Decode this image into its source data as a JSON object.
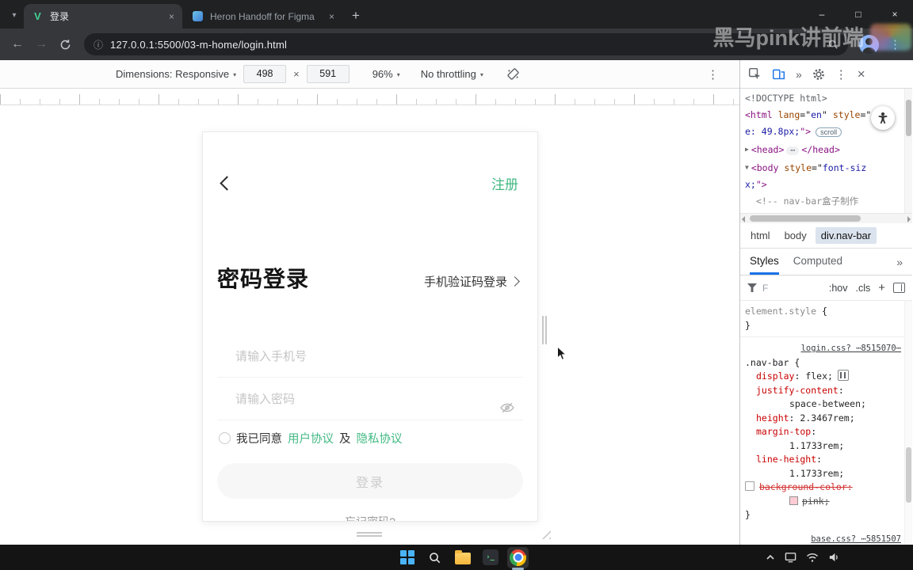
{
  "colors": {
    "accent_green": "#42b983",
    "devtools_blue": "#1a73e8",
    "disabled_pink": "#ffc0cb"
  },
  "icons": {
    "tab_search": "▾",
    "close_tab": "×",
    "new_tab": "+",
    "minimize": "–",
    "maximize": "□",
    "close_window": "×",
    "back": "←",
    "forward": "→",
    "info": "ⓘ",
    "kebab": "⋮",
    "more_panels": "»",
    "caret": "▾",
    "devtools_close": "×"
  },
  "browser": {
    "tabs": [
      {
        "title": "登录"
      },
      {
        "title": "Heron Handoff for Figma"
      }
    ],
    "url": "127.0.0.1:5500/03-m-home/login.html",
    "watermark": "黑马pink讲前端"
  },
  "device_toolbar": {
    "dimensions_label": "Dimensions: Responsive",
    "width": "498",
    "multiply": "×",
    "height": "591",
    "zoom": "96%",
    "throttling": "No throttling"
  },
  "page": {
    "register": "注册",
    "title": "密码登录",
    "alt_login": "手机验证码登录",
    "phone_placeholder": "请输入手机号",
    "password_placeholder": "请输入密码",
    "agree_prefix": "我已同意",
    "user_agreement": "用户协议",
    "and": "及",
    "privacy_agreement": "隐私协议",
    "login_button": "登录",
    "forgot_password": "忘记密码?"
  },
  "elements": {
    "dom_lines": [
      {
        "tokens": [
          {
            "c": "doctype",
            "t": "<!DOCTYPE html>"
          }
        ]
      },
      {
        "tokens": [
          {
            "c": "tag",
            "t": "<html"
          },
          {
            "c": "plain",
            "t": " "
          },
          {
            "c": "attr",
            "t": "lang"
          },
          {
            "c": "plain",
            "t": "=\""
          },
          {
            "c": "str",
            "t": "en"
          },
          {
            "c": "plain",
            "t": "\" "
          },
          {
            "c": "attr",
            "t": "style"
          },
          {
            "c": "plain",
            "t": "=\""
          },
          {
            "c": "str",
            "t": "f"
          }
        ]
      },
      {
        "tokens": [
          {
            "c": "str",
            "t": "e: 49.8px;"
          },
          {
            "c": "tag",
            "t": "\">"
          },
          {
            "k": "badge",
            "t": "scroll"
          }
        ]
      },
      {
        "tokens": [
          {
            "c": "arrow",
            "t": "▶"
          },
          {
            "c": "tag",
            "t": "<head>"
          },
          {
            "c": "dots",
            "t": "⋯"
          },
          {
            "c": "tag",
            "t": "</head>"
          }
        ]
      },
      {
        "tokens": [
          {
            "c": "arrow",
            "t": "▼"
          },
          {
            "c": "tag",
            "t": "<body"
          },
          {
            "c": "plain",
            "t": " "
          },
          {
            "c": "attr",
            "t": "style"
          },
          {
            "c": "plain",
            "t": "=\""
          },
          {
            "c": "str",
            "t": "font-siz"
          }
        ]
      },
      {
        "tokens": [
          {
            "c": "str",
            "t": "x;"
          },
          {
            "c": "tag",
            "t": "\">"
          }
        ]
      },
      {
        "indent": 1,
        "tokens": [
          {
            "c": "comment",
            "t": "<!-- nav-bar盒子制作"
          }
        ]
      }
    ],
    "breadcrumbs": [
      {
        "t": "html"
      },
      {
        "t": "body"
      },
      {
        "t": "div.nav-bar",
        "sel": true
      }
    ]
  },
  "styles": {
    "tabs": {
      "styles": "Styles",
      "computed": "Computed"
    },
    "filter": {
      "placeholder": "F",
      "hov": ":hov",
      "cls": ".cls",
      "plus": "+"
    },
    "lines": [
      {
        "tokens": [
          {
            "c": "gray",
            "t": "element.style"
          },
          {
            "c": "plain",
            "t": " {"
          }
        ]
      },
      {
        "tokens": [
          {
            "c": "plain",
            "t": "}"
          }
        ]
      },
      {
        "cls": "hr"
      },
      {
        "cls": "right",
        "tokens": [
          {
            "c": "link",
            "t": "login.css? ⋯8515070⋯"
          }
        ]
      },
      {
        "tokens": [
          {
            "c": "sel-tok",
            "t": ".nav-bar"
          },
          {
            "c": "plain",
            "t": " {"
          }
        ]
      },
      {
        "indent": 1,
        "tokens": [
          {
            "c": "prop",
            "t": "display"
          },
          {
            "c": "plain",
            "t": ": "
          },
          {
            "c": "val",
            "t": "flex;"
          },
          {
            "k": "flexicon"
          }
        ]
      },
      {
        "indent": 1,
        "tokens": [
          {
            "c": "prop",
            "t": "justify-content"
          },
          {
            "c": "plain",
            "t": ":"
          }
        ]
      },
      {
        "indent": 2,
        "tokens": [
          {
            "c": "val",
            "t": "space-between;"
          }
        ]
      },
      {
        "indent": 1,
        "tokens": [
          {
            "c": "prop",
            "t": "height"
          },
          {
            "c": "plain",
            "t": ": "
          },
          {
            "c": "val",
            "t": "2.3467rem;"
          }
        ]
      },
      {
        "indent": 1,
        "tokens": [
          {
            "c": "prop",
            "t": "margin-top"
          },
          {
            "c": "plain",
            "t": ":"
          }
        ]
      },
      {
        "indent": 2,
        "tokens": [
          {
            "c": "val",
            "t": "1.1733rem;"
          }
        ]
      },
      {
        "indent": 1,
        "tokens": [
          {
            "c": "prop",
            "t": "line-height"
          },
          {
            "c": "plain",
            "t": ":"
          }
        ]
      },
      {
        "indent": 2,
        "tokens": [
          {
            "c": "val",
            "t": "1.1733rem;"
          }
        ]
      },
      {
        "cls": "disabled",
        "tokens": [
          {
            "k": "checkbox"
          },
          {
            "c": "prop strike",
            "t": "background-color:"
          }
        ]
      },
      {
        "indent": 2,
        "cls": "disabled",
        "tokens": [
          {
            "k": "swatch",
            "color": "#ffc0cb"
          },
          {
            "c": "val strike",
            "t": "pink;"
          }
        ]
      },
      {
        "tokens": [
          {
            "c": "plain",
            "t": "}"
          }
        ]
      },
      {
        "cls": "right gap-top",
        "tokens": [
          {
            "c": "link",
            "t": "base.css? ⋯5851507"
          }
        ]
      }
    ]
  }
}
